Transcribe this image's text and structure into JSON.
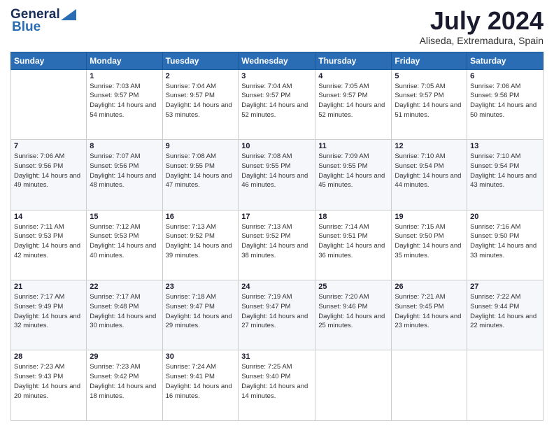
{
  "header": {
    "logo_general": "General",
    "logo_blue": "Blue",
    "month_title": "July 2024",
    "location": "Aliseda, Extremadura, Spain"
  },
  "weekdays": [
    "Sunday",
    "Monday",
    "Tuesday",
    "Wednesday",
    "Thursday",
    "Friday",
    "Saturday"
  ],
  "weeks": [
    [
      {
        "day": "",
        "sunrise": "",
        "sunset": "",
        "daylight": ""
      },
      {
        "day": "1",
        "sunrise": "Sunrise: 7:03 AM",
        "sunset": "Sunset: 9:57 PM",
        "daylight": "Daylight: 14 hours and 54 minutes."
      },
      {
        "day": "2",
        "sunrise": "Sunrise: 7:04 AM",
        "sunset": "Sunset: 9:57 PM",
        "daylight": "Daylight: 14 hours and 53 minutes."
      },
      {
        "day": "3",
        "sunrise": "Sunrise: 7:04 AM",
        "sunset": "Sunset: 9:57 PM",
        "daylight": "Daylight: 14 hours and 52 minutes."
      },
      {
        "day": "4",
        "sunrise": "Sunrise: 7:05 AM",
        "sunset": "Sunset: 9:57 PM",
        "daylight": "Daylight: 14 hours and 52 minutes."
      },
      {
        "day": "5",
        "sunrise": "Sunrise: 7:05 AM",
        "sunset": "Sunset: 9:57 PM",
        "daylight": "Daylight: 14 hours and 51 minutes."
      },
      {
        "day": "6",
        "sunrise": "Sunrise: 7:06 AM",
        "sunset": "Sunset: 9:56 PM",
        "daylight": "Daylight: 14 hours and 50 minutes."
      }
    ],
    [
      {
        "day": "7",
        "sunrise": "Sunrise: 7:06 AM",
        "sunset": "Sunset: 9:56 PM",
        "daylight": "Daylight: 14 hours and 49 minutes."
      },
      {
        "day": "8",
        "sunrise": "Sunrise: 7:07 AM",
        "sunset": "Sunset: 9:56 PM",
        "daylight": "Daylight: 14 hours and 48 minutes."
      },
      {
        "day": "9",
        "sunrise": "Sunrise: 7:08 AM",
        "sunset": "Sunset: 9:55 PM",
        "daylight": "Daylight: 14 hours and 47 minutes."
      },
      {
        "day": "10",
        "sunrise": "Sunrise: 7:08 AM",
        "sunset": "Sunset: 9:55 PM",
        "daylight": "Daylight: 14 hours and 46 minutes."
      },
      {
        "day": "11",
        "sunrise": "Sunrise: 7:09 AM",
        "sunset": "Sunset: 9:55 PM",
        "daylight": "Daylight: 14 hours and 45 minutes."
      },
      {
        "day": "12",
        "sunrise": "Sunrise: 7:10 AM",
        "sunset": "Sunset: 9:54 PM",
        "daylight": "Daylight: 14 hours and 44 minutes."
      },
      {
        "day": "13",
        "sunrise": "Sunrise: 7:10 AM",
        "sunset": "Sunset: 9:54 PM",
        "daylight": "Daylight: 14 hours and 43 minutes."
      }
    ],
    [
      {
        "day": "14",
        "sunrise": "Sunrise: 7:11 AM",
        "sunset": "Sunset: 9:53 PM",
        "daylight": "Daylight: 14 hours and 42 minutes."
      },
      {
        "day": "15",
        "sunrise": "Sunrise: 7:12 AM",
        "sunset": "Sunset: 9:53 PM",
        "daylight": "Daylight: 14 hours and 40 minutes."
      },
      {
        "day": "16",
        "sunrise": "Sunrise: 7:13 AM",
        "sunset": "Sunset: 9:52 PM",
        "daylight": "Daylight: 14 hours and 39 minutes."
      },
      {
        "day": "17",
        "sunrise": "Sunrise: 7:13 AM",
        "sunset": "Sunset: 9:52 PM",
        "daylight": "Daylight: 14 hours and 38 minutes."
      },
      {
        "day": "18",
        "sunrise": "Sunrise: 7:14 AM",
        "sunset": "Sunset: 9:51 PM",
        "daylight": "Daylight: 14 hours and 36 minutes."
      },
      {
        "day": "19",
        "sunrise": "Sunrise: 7:15 AM",
        "sunset": "Sunset: 9:50 PM",
        "daylight": "Daylight: 14 hours and 35 minutes."
      },
      {
        "day": "20",
        "sunrise": "Sunrise: 7:16 AM",
        "sunset": "Sunset: 9:50 PM",
        "daylight": "Daylight: 14 hours and 33 minutes."
      }
    ],
    [
      {
        "day": "21",
        "sunrise": "Sunrise: 7:17 AM",
        "sunset": "Sunset: 9:49 PM",
        "daylight": "Daylight: 14 hours and 32 minutes."
      },
      {
        "day": "22",
        "sunrise": "Sunrise: 7:17 AM",
        "sunset": "Sunset: 9:48 PM",
        "daylight": "Daylight: 14 hours and 30 minutes."
      },
      {
        "day": "23",
        "sunrise": "Sunrise: 7:18 AM",
        "sunset": "Sunset: 9:47 PM",
        "daylight": "Daylight: 14 hours and 29 minutes."
      },
      {
        "day": "24",
        "sunrise": "Sunrise: 7:19 AM",
        "sunset": "Sunset: 9:47 PM",
        "daylight": "Daylight: 14 hours and 27 minutes."
      },
      {
        "day": "25",
        "sunrise": "Sunrise: 7:20 AM",
        "sunset": "Sunset: 9:46 PM",
        "daylight": "Daylight: 14 hours and 25 minutes."
      },
      {
        "day": "26",
        "sunrise": "Sunrise: 7:21 AM",
        "sunset": "Sunset: 9:45 PM",
        "daylight": "Daylight: 14 hours and 23 minutes."
      },
      {
        "day": "27",
        "sunrise": "Sunrise: 7:22 AM",
        "sunset": "Sunset: 9:44 PM",
        "daylight": "Daylight: 14 hours and 22 minutes."
      }
    ],
    [
      {
        "day": "28",
        "sunrise": "Sunrise: 7:23 AM",
        "sunset": "Sunset: 9:43 PM",
        "daylight": "Daylight: 14 hours and 20 minutes."
      },
      {
        "day": "29",
        "sunrise": "Sunrise: 7:23 AM",
        "sunset": "Sunset: 9:42 PM",
        "daylight": "Daylight: 14 hours and 18 minutes."
      },
      {
        "day": "30",
        "sunrise": "Sunrise: 7:24 AM",
        "sunset": "Sunset: 9:41 PM",
        "daylight": "Daylight: 14 hours and 16 minutes."
      },
      {
        "day": "31",
        "sunrise": "Sunrise: 7:25 AM",
        "sunset": "Sunset: 9:40 PM",
        "daylight": "Daylight: 14 hours and 14 minutes."
      },
      {
        "day": "",
        "sunrise": "",
        "sunset": "",
        "daylight": ""
      },
      {
        "day": "",
        "sunrise": "",
        "sunset": "",
        "daylight": ""
      },
      {
        "day": "",
        "sunrise": "",
        "sunset": "",
        "daylight": ""
      }
    ]
  ]
}
